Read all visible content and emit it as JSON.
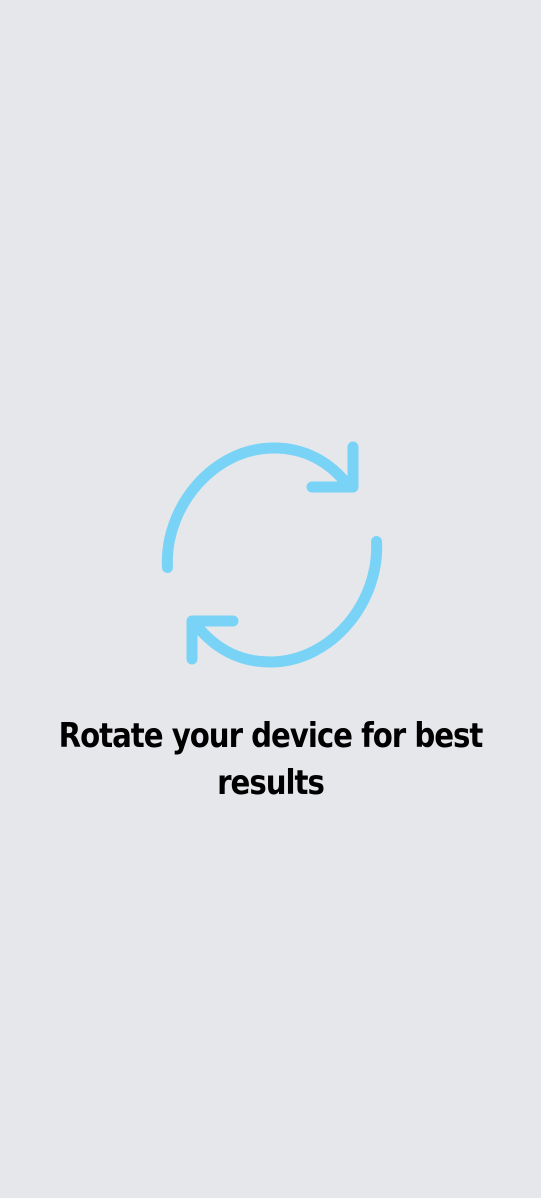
{
  "overlay": {
    "icon": "rotate-arrows-icon",
    "message": "Rotate your device for best results"
  },
  "colors": {
    "background": "#e6e7eb",
    "icon": "#79d3f6",
    "text": "#000000"
  }
}
